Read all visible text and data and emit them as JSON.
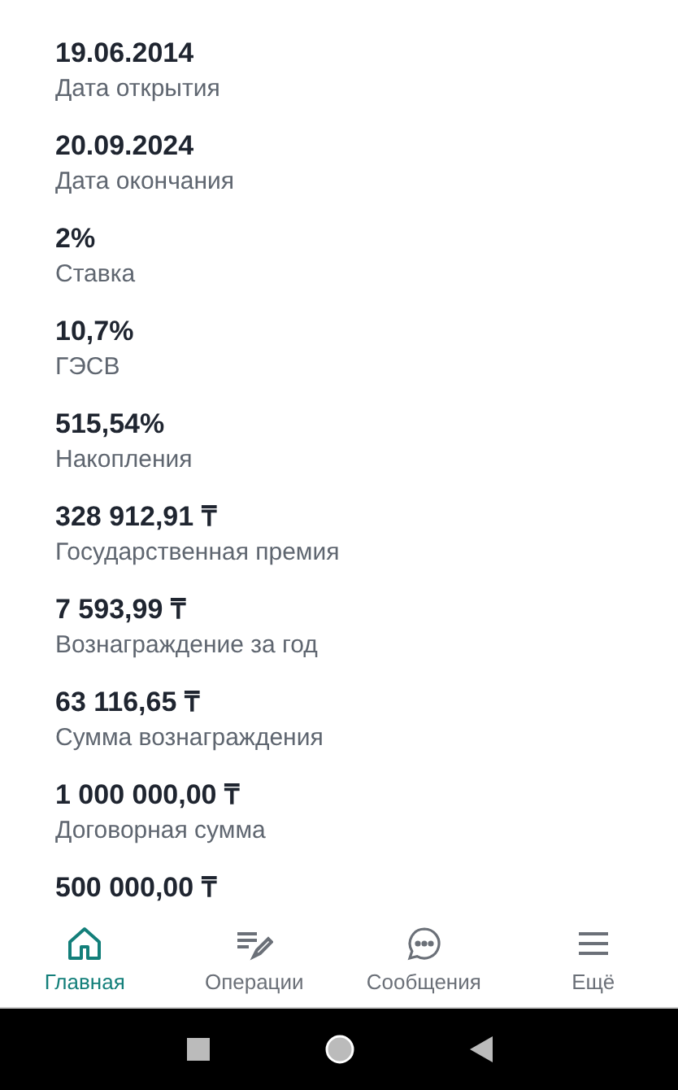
{
  "details": [
    {
      "value": "19.06.2014",
      "label": "Дата открытия"
    },
    {
      "value": "20.09.2024",
      "label": "Дата окончания"
    },
    {
      "value": "2%",
      "label": "Ставка"
    },
    {
      "value": "10,7%",
      "label": "ГЭСВ"
    },
    {
      "value": "515,54%",
      "label": "Накопления"
    },
    {
      "value": "328 912,91 ₸",
      "label": "Государственная премия"
    },
    {
      "value": "7 593,99 ₸",
      "label": "Вознаграждение за год"
    },
    {
      "value": "63 116,65 ₸",
      "label": "Сумма вознаграждения"
    },
    {
      "value": "1 000 000,00 ₸",
      "label": "Договорная сумма"
    },
    {
      "value": "500 000,00 ₸"
    }
  ],
  "nav": [
    {
      "kind": "home",
      "label": "Главная",
      "selected": true
    },
    {
      "kind": "operations",
      "label": "Операции",
      "selected": false
    },
    {
      "kind": "messages",
      "label": "Сообщения",
      "selected": false
    },
    {
      "kind": "more",
      "label": "Ещё",
      "selected": false
    }
  ]
}
